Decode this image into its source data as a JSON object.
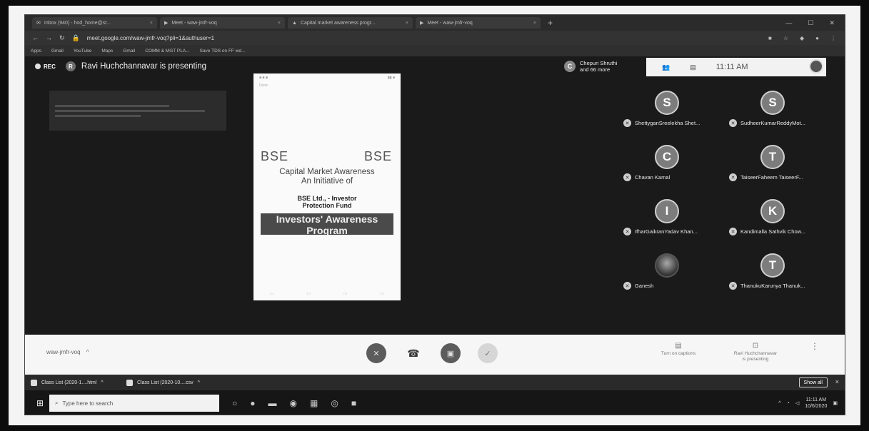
{
  "browser": {
    "tabs": [
      {
        "label": "Inbox (940) - hod_home@st..."
      },
      {
        "label": "Meet - waw-jmfr-voq"
      },
      {
        "label": "Capital market awareness progr..."
      },
      {
        "label": "Meet - waw-jmfr-voq"
      }
    ],
    "new_tab": "+",
    "url": "meet.google.com/waw-jmfr-voq?pli=1&authuser=1",
    "bookmarks": [
      "Apps",
      "Gmail",
      "YouTube",
      "Maps",
      "Gmail",
      "COMM & MGT PLA...",
      "Save TDS on FF wd..."
    ]
  },
  "meet": {
    "rec_label": "REC",
    "presenter_initial": "R",
    "presenting_text": "Ravi Huchchannavar is presenting",
    "others_initial": "C",
    "others_text_line1": "Chepuri Shruthi",
    "others_text_line2": "and 66 more",
    "time": "11:11 AM",
    "slide": {
      "logo_left": "BSE",
      "logo_right": "BSE",
      "caption_line1": "Capital Market Awareness",
      "caption_line2": "An Initiative of",
      "org_line1": "BSE Ltd., - Investor",
      "org_line2": "Protection Fund",
      "banner_line1": "Investors' Awareness",
      "banner_line2": "Program"
    },
    "participants": [
      {
        "initial": "S",
        "name": "ShettyganSreelekha Shet..."
      },
      {
        "initial": "S",
        "name": "SudheerKumarReddyMot..."
      },
      {
        "initial": "C",
        "name": "Chavan Kamal"
      },
      {
        "initial": "T",
        "name": "TaiseerFaheem TaiseerF..."
      },
      {
        "initial": "I",
        "name": "IfharGaikranYadav Khan..."
      },
      {
        "initial": "K",
        "name": "Kandimalla Sathvik Chow..."
      },
      {
        "initial": "",
        "name": "Ganesh"
      },
      {
        "initial": "T",
        "name": "ThanukuKarunya Thanuk..."
      }
    ]
  },
  "controls": {
    "meeting_name": "waw-jmfr-voq",
    "caret": "^",
    "captions_label": "Turn on captions",
    "presenter_label_line1": "Ravi Huchchannavar",
    "presenter_label_line2": "is presenting",
    "more": "⋮"
  },
  "downloads": {
    "items": [
      {
        "label": "Class List (2020-1....html"
      },
      {
        "label": "Class List (2020-10....csv"
      }
    ],
    "show_all": "Show all",
    "close": "×"
  },
  "taskbar": {
    "search_placeholder": "Type here to search",
    "time": "11:11 AM",
    "date": "10/6/2020"
  }
}
